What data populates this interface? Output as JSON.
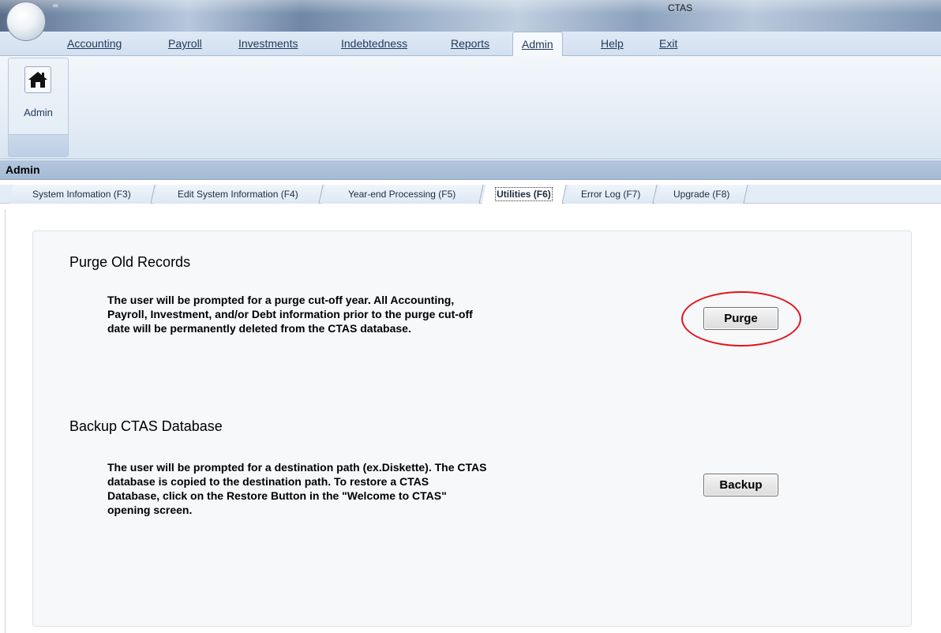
{
  "window": {
    "title": "CTAS",
    "qat_glyph": "="
  },
  "menu": {
    "items": [
      {
        "label": "Accounting"
      },
      {
        "label": "Payroll"
      },
      {
        "label": "Investments"
      },
      {
        "label": "Indebtedness"
      },
      {
        "label": "Reports"
      },
      {
        "label": "Admin",
        "active": true
      },
      {
        "label": "Help"
      },
      {
        "label": "Exit"
      }
    ]
  },
  "ribbon": {
    "button_label": "Admin",
    "icon": "home-icon"
  },
  "section": {
    "title": "Admin"
  },
  "tabs": [
    {
      "label": "System Infomation (F3)"
    },
    {
      "label": "Edit System Information (F4)"
    },
    {
      "label": "Year-end Processing  (F5)"
    },
    {
      "label": "Utilities (F6)",
      "selected": true
    },
    {
      "label": "Error Log (F7)"
    },
    {
      "label": "Upgrade (F8)"
    }
  ],
  "purge": {
    "heading": "Purge Old Records",
    "lines": [
      "The user will be prompted for a purge cut-off year. All Accounting,",
      "Payroll, Investment, and/or Debt information prior to the purge cut-off",
      "date will be permanently deleted from the CTAS database."
    ],
    "button_label": "Purge",
    "highlight_color": "#e2141b"
  },
  "backup": {
    "heading": "Backup CTAS Database",
    "lines": [
      "The user will be prompted for a destination path (ex.Diskette). The CTAS",
      "database is copied to the destination path. To restore a CTAS",
      "Database, click on the Restore Button in the \"Welcome to CTAS\"",
      "opening screen."
    ],
    "button_label": "Backup"
  }
}
